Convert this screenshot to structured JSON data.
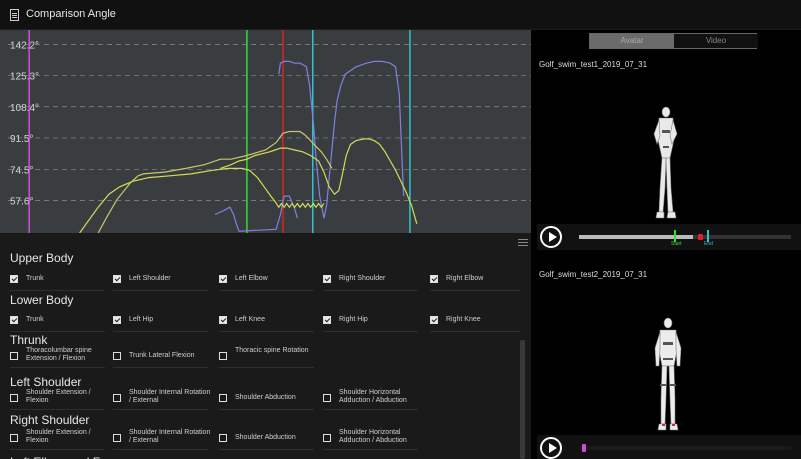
{
  "window": {
    "title": "Comparison Angle"
  },
  "chart_data": {
    "type": "line",
    "title": "",
    "xlabel": "",
    "ylabel": "",
    "y_ticks": [
      "142.2°",
      "125.3°",
      "108.4°",
      "91.5°",
      "74.5°",
      "57.6°"
    ],
    "ylim": [
      40,
      150
    ],
    "xlim": [
      0,
      100
    ],
    "grid": true,
    "vertical_markers": [
      {
        "x": 5.5,
        "color": "#d24be0"
      },
      {
        "x": 46.5,
        "color": "#33dd33"
      },
      {
        "x": 53.3,
        "color": "#dd2222"
      },
      {
        "x": 58.9,
        "color": "#2fc4cf"
      },
      {
        "x": 77.2,
        "color": "#2fc4cf"
      }
    ],
    "series": [
      {
        "color": "#7c82e0",
        "x": [
          52.5,
          52.8,
          53.5,
          54.5,
          55.5,
          56.5,
          57.2,
          57.7,
          58.3,
          59.0,
          59.6,
          60.2,
          61.0,
          61.5,
          62.0,
          62.5,
          63.0,
          63.5,
          64.2,
          65.0,
          66.0,
          67.0,
          68.0,
          69.0,
          70.5,
          72.0,
          73.5,
          74.5,
          75.2,
          76.0
        ],
        "y": [
          126,
          132,
          133,
          133,
          132,
          132,
          131,
          130,
          120,
          100,
          78,
          60,
          48,
          55,
          70,
          85,
          100,
          112,
          120,
          126,
          128,
          130,
          131,
          132,
          133,
          133,
          132,
          130,
          115,
          60
        ]
      },
      {
        "color": "#7c82e0",
        "x": [
          40.5,
          42.0,
          43.3,
          44.0,
          44.5,
          45.0,
          52.0,
          52.8,
          53.5,
          54.5,
          55.5,
          56.0
        ],
        "y": [
          50,
          52,
          54,
          50,
          45,
          41,
          42,
          50,
          60,
          60,
          53,
          48
        ]
      },
      {
        "color": "#d2dc55",
        "x": [
          15.0,
          16.5,
          18.5,
          20.5,
          22.5,
          25.0,
          28.0,
          32.0,
          36.0,
          40.0,
          43.0,
          45.5,
          47.0,
          48.5,
          50.0,
          51.0,
          51.8,
          52.5,
          53.0,
          53.5,
          54.0,
          54.5,
          55.0,
          55.5,
          56.0,
          56.5,
          57.0,
          57.5,
          58.0,
          58.5,
          59.0,
          59.5,
          60.0,
          60.5,
          61.0
        ],
        "y": [
          40,
          46,
          54,
          61,
          65,
          68,
          70,
          71,
          72,
          74,
          75,
          75,
          74,
          70,
          64,
          60,
          57,
          54,
          56,
          54,
          56,
          54,
          56,
          54,
          56,
          54,
          56,
          54,
          56,
          54,
          56,
          54,
          56,
          54,
          56
        ]
      },
      {
        "color": "#d2dc55",
        "x": [
          41.5,
          43.5,
          45.0,
          46.5,
          48.0,
          49.5,
          50.8,
          51.8,
          52.8,
          54.0,
          55.5,
          57.0,
          58.5,
          60.0,
          61.0,
          62.0,
          63.0,
          63.8,
          64.5,
          65.2,
          66.0,
          67.0,
          68.5,
          69.5,
          70.5,
          71.5,
          72.5,
          73.5,
          74.5,
          75.5,
          76.5,
          77.5,
          78.5
        ],
        "y": [
          75,
          77,
          79,
          80,
          82,
          83,
          84,
          85,
          86,
          86,
          85,
          84,
          82,
          79,
          73,
          65,
          61,
          63,
          72,
          82,
          88,
          90,
          91,
          91,
          90,
          88,
          84,
          79,
          74,
          68,
          62,
          55,
          45
        ]
      },
      {
        "color": "#c8c86e",
        "x": [
          18.5,
          20.0,
          22.0,
          24.5,
          26.0,
          27.0,
          31.0,
          35.0,
          38.5,
          41.5,
          43.5,
          46.5,
          50.0,
          52.0,
          53.3,
          54.5,
          55.5,
          56.5,
          57.5,
          58.5,
          59.5,
          60.5,
          61.5,
          62.5
        ],
        "y": [
          40,
          48,
          58,
          67,
          71,
          72,
          73,
          75,
          77,
          80,
          80,
          82,
          85,
          89,
          94,
          95,
          95,
          95,
          93,
          90,
          87,
          84,
          80,
          75
        ]
      }
    ]
  },
  "panel": {
    "sections": [
      {
        "title": "Upper Body",
        "items": [
          {
            "label": "Trunk",
            "checked": true
          },
          {
            "label": "Left Shoulder",
            "checked": true
          },
          {
            "label": "Left Elbow",
            "checked": true
          },
          {
            "label": "Right Shoulder",
            "checked": true
          },
          {
            "label": "Right Elbow",
            "checked": true
          }
        ]
      },
      {
        "title": "Lower Body",
        "items": [
          {
            "label": "Trunk",
            "checked": true
          },
          {
            "label": "Left Hip",
            "checked": true
          },
          {
            "label": "Left Knee",
            "checked": true
          },
          {
            "label": "Right Hip",
            "checked": true
          },
          {
            "label": "Right Knee",
            "checked": true
          }
        ]
      },
      {
        "title": "Thrunk",
        "items": [
          {
            "label": "Thoracolumbar spine Extension / Flexion",
            "checked": false
          },
          {
            "label": "Trunk Lateral Flexion",
            "checked": false
          },
          {
            "label": "Thoracic spine Rotation",
            "checked": false
          }
        ]
      },
      {
        "title": "Left Shoulder",
        "items": [
          {
            "label": "Shoulder Extension / Flexion",
            "checked": false
          },
          {
            "label": "Shoulder Internal Rotation / External",
            "checked": false
          },
          {
            "label": "Shoulder Abduction",
            "checked": false
          },
          {
            "label": "Shoulder Horizontal Adduction / Abduction",
            "checked": false
          }
        ]
      },
      {
        "title": "Right Shoulder",
        "items": [
          {
            "label": "Shoulder Extension / Flexion",
            "checked": false
          },
          {
            "label": "Shoulder Internal Rotation / External",
            "checked": false
          },
          {
            "label": "Shoulder Abduction",
            "checked": false
          },
          {
            "label": "Shoulder Horizontal Adduction / Abduction",
            "checked": false
          }
        ]
      },
      {
        "title": "Left Elbow and Forearm",
        "items": []
      }
    ]
  },
  "viewer": {
    "tabs": {
      "avatar": "Avatar",
      "video": "Video"
    },
    "clip1": {
      "name": "Golf_swim_test1_2019_07_31",
      "progress": 0.54,
      "start_label": "Start",
      "end_label": "End",
      "start_color": "#33dd33",
      "end_color": "#2fc4cf",
      "playhead_color": "#dd2222"
    },
    "clip2": {
      "name": "Golf_swim_test2_2019_07_31",
      "playhead_color": "#d24be0"
    }
  }
}
